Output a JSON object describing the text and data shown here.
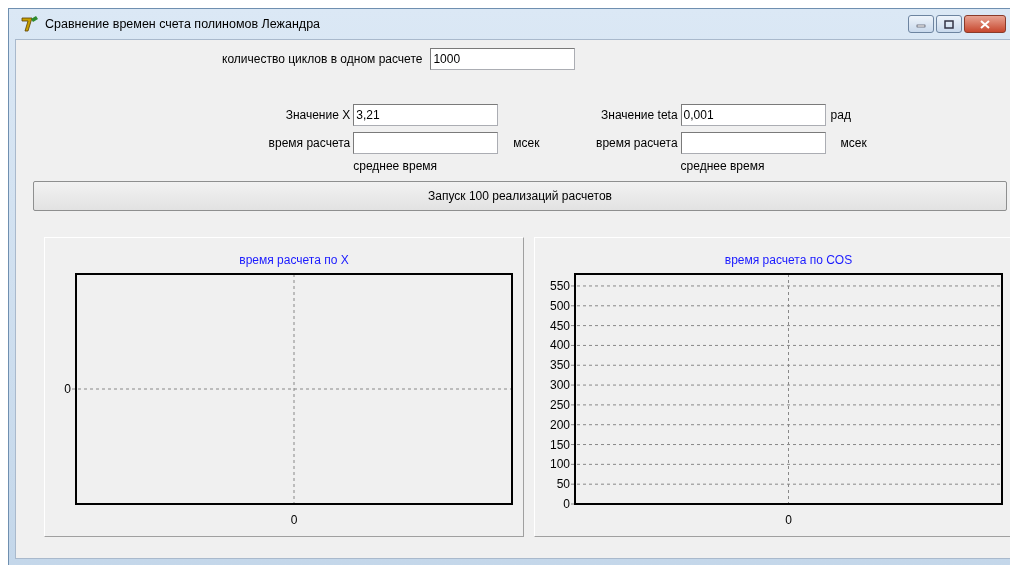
{
  "window": {
    "title": "Сравнение времен счета полиномов Лежандра"
  },
  "cycles": {
    "label": "количество циклов в одном расчете",
    "value": "1000"
  },
  "groups": [
    {
      "label": "Значение X",
      "value": "3,21",
      "time_label": "время расчета",
      "time_value_unit": "мсек",
      "average_label": "среднее время"
    },
    {
      "label": "Значение teta",
      "value": "0,001",
      "unit": "рад",
      "time_label": "время расчета",
      "time_value_unit": "мсек",
      "average_label": "среднее время"
    }
  ],
  "run_button": {
    "label": "Запуск 100 реализаций расчетов"
  },
  "charts": [
    {
      "title": "время расчета по X",
      "x_axis_labels": [
        "0"
      ],
      "y_axis_labels": [
        "0"
      ]
    },
    {
      "title": "время расчета по COS",
      "x_axis_labels": [
        "0"
      ],
      "y_axis_labels": [
        "550",
        "500",
        "450",
        "400",
        "350",
        "300",
        "250",
        "200",
        "150",
        "100",
        "50",
        "0"
      ]
    }
  ]
}
